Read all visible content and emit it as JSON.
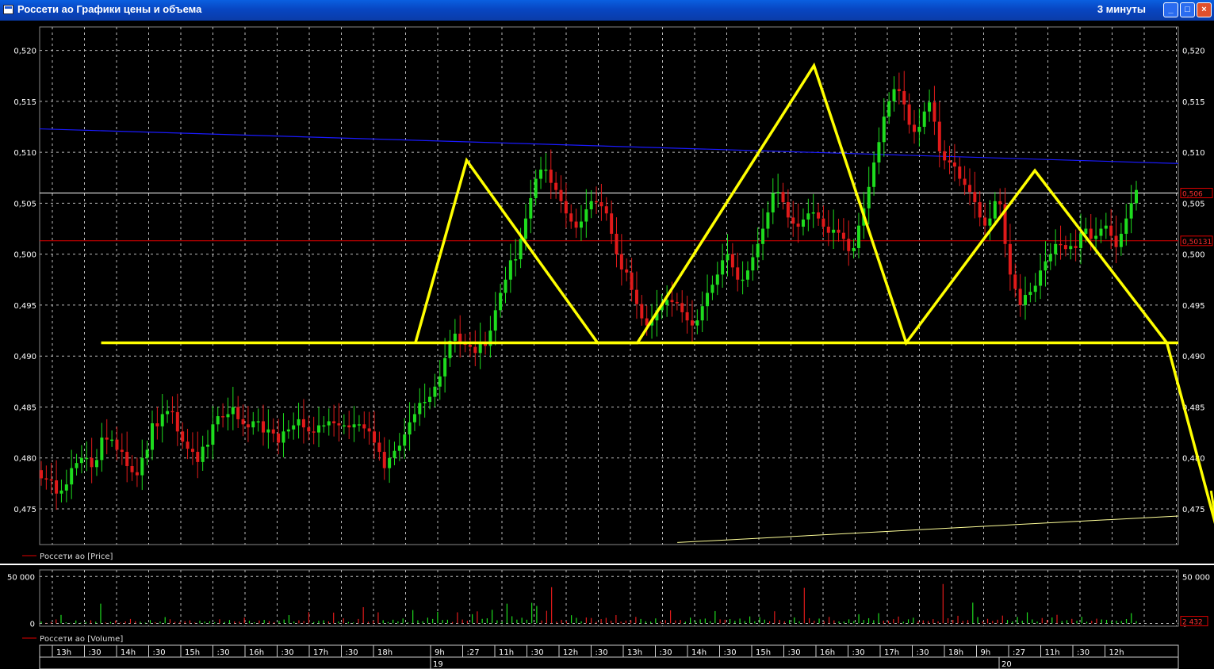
{
  "window": {
    "title": "Россети ао Графики цены и объема",
    "interval": "3 минуты",
    "minimize_glyph": "_",
    "maximize_glyph": "□",
    "close_glyph": "×"
  },
  "chart_data": {
    "type": "candlestick",
    "price_panel": {
      "legend": "Россети ао [Price]",
      "ylim": [
        0.4715,
        0.5223
      ],
      "yticks": [
        0.475,
        0.48,
        0.485,
        0.49,
        0.495,
        0.5,
        0.505,
        0.51,
        0.515,
        0.52
      ],
      "ytick_labels": [
        "0,475",
        "0,480",
        "0,485",
        "0,490",
        "0,495",
        "0,500",
        "0,505",
        "0,510",
        "0,515",
        "0,520"
      ],
      "grid": true,
      "price_markers": [
        {
          "value": 0.506,
          "label": "0,506",
          "color": "#ffffff"
        },
        {
          "value": 0.50131,
          "label": "0,50131",
          "color": "#e00000"
        }
      ],
      "moving_average": {
        "color": "#1a1aff",
        "t": [
          0,
          1
        ],
        "values": [
          0.5123,
          0.5089
        ]
      },
      "lower_line": {
        "color": "#ffff99",
        "t": [
          0.56,
          1
        ],
        "values": [
          0.4717,
          0.4743
        ]
      },
      "annotations": {
        "color": "#ffff00",
        "neckline": {
          "t": [
            0.054,
            1
          ],
          "value": 0.4913
        },
        "zigzag": {
          "t": [
            0.33,
            0.375,
            0.49,
            0.525,
            0.68,
            0.761,
            0.874,
            0.99,
            1.035
          ],
          "values": [
            0.4913,
            0.5092,
            0.4913,
            0.4913,
            0.5185,
            0.4913,
            0.5082,
            0.4913,
            0.4725
          ]
        }
      },
      "candles_close": [
        0.478,
        0.4779,
        0.4778,
        0.4765,
        0.4768,
        0.4774,
        0.479,
        0.4795,
        0.48,
        0.48,
        0.4791,
        0.4798,
        0.482,
        0.4818,
        0.4818,
        0.4808,
        0.4806,
        0.4792,
        0.4786,
        0.4783,
        0.48,
        0.4808,
        0.4834,
        0.4831,
        0.4843,
        0.4846,
        0.4845,
        0.4826,
        0.4816,
        0.4809,
        0.4806,
        0.4796,
        0.4811,
        0.4813,
        0.4833,
        0.4841,
        0.484,
        0.4843,
        0.485,
        0.4838,
        0.4833,
        0.483,
        0.4836,
        0.4836,
        0.4825,
        0.4828,
        0.4824,
        0.4815,
        0.4826,
        0.4828,
        0.4832,
        0.4838,
        0.483,
        0.4826,
        0.4825,
        0.4832,
        0.4832,
        0.4836,
        0.4834,
        0.4832,
        0.4832,
        0.483,
        0.4833,
        0.4833,
        0.4829,
        0.4826,
        0.4815,
        0.4806,
        0.479,
        0.48,
        0.4807,
        0.4812,
        0.4823,
        0.4835,
        0.4843,
        0.4854,
        0.4855,
        0.486,
        0.487,
        0.488,
        0.4898,
        0.4915,
        0.4922,
        0.4913,
        0.4911,
        0.4909,
        0.4903,
        0.4913,
        0.491,
        0.4925,
        0.4945,
        0.4962,
        0.4975,
        0.4994,
        0.4995,
        0.5015,
        0.5035,
        0.5055,
        0.5074,
        0.5083,
        0.5083,
        0.507,
        0.5063,
        0.5052,
        0.504,
        0.5032,
        0.5026,
        0.5032,
        0.5044,
        0.5052,
        0.5051,
        0.5047,
        0.504,
        0.502,
        0.5,
        0.4985,
        0.4982,
        0.4965,
        0.4951,
        0.4937,
        0.493,
        0.4935,
        0.4945,
        0.495,
        0.4955,
        0.4953,
        0.4952,
        0.4943,
        0.4935,
        0.493,
        0.4935,
        0.4949,
        0.4962,
        0.497,
        0.498,
        0.4994,
        0.5,
        0.4987,
        0.4975,
        0.4975,
        0.4984,
        0.4997,
        0.501,
        0.5025,
        0.5041,
        0.506,
        0.5061,
        0.5051,
        0.5036,
        0.503,
        0.5027,
        0.5034,
        0.504,
        0.5041,
        0.5035,
        0.5027,
        0.5021,
        0.5024,
        0.5021,
        0.5015,
        0.5003,
        0.5006,
        0.5028,
        0.5045,
        0.5066,
        0.509,
        0.511,
        0.5135,
        0.515,
        0.5162,
        0.516,
        0.5147,
        0.5127,
        0.512,
        0.5125,
        0.514,
        0.5149,
        0.513,
        0.5101,
        0.5092,
        0.509,
        0.5086,
        0.5074,
        0.5068,
        0.5061,
        0.5051,
        0.5036,
        0.5028,
        0.5035,
        0.5052,
        0.5049,
        0.501,
        0.498,
        0.4966,
        0.495,
        0.496,
        0.4963,
        0.4969,
        0.4984,
        0.4993,
        0.5,
        0.501,
        0.5009,
        0.5005,
        0.5008,
        0.5006,
        0.502,
        0.5025,
        0.5015,
        0.5018,
        0.5025,
        0.5028,
        0.5018,
        0.5007,
        0.502,
        0.5035,
        0.505,
        0.5063
      ]
    },
    "volume_panel": {
      "legend": "Россети ао [Volume]",
      "ylim": [
        -3000,
        57000
      ],
      "yticks": [
        0,
        50000
      ],
      "ytick_labels": [
        "0",
        "50 000"
      ],
      "last_value": 2432,
      "last_label": "2 432",
      "values": [
        2000,
        600,
        1400,
        4200,
        9000,
        1100,
        500,
        3100,
        700,
        1600,
        3300,
        1800,
        21000,
        1000,
        1500,
        2900,
        800,
        2100,
        4700,
        2300,
        1700,
        800,
        3500,
        1200,
        1800,
        6700,
        4400,
        1700,
        1500,
        2300,
        3200,
        900,
        2800,
        1900,
        2200,
        1100,
        4400,
        1500,
        3600,
        2100,
        1800,
        6100,
        2800,
        1200,
        3100,
        3700,
        2400,
        1300,
        2600,
        4100,
        8800,
        1900,
        3300,
        2500,
        12000,
        1400,
        2800,
        3300,
        2100,
        11500,
        1900,
        5400,
        1500,
        900,
        4700,
        17300,
        1800,
        2900,
        11800,
        3400,
        1500,
        3900,
        2100,
        5200,
        1100,
        14200,
        3300,
        2300,
        6100,
        4700,
        12300,
        3700,
        3900,
        1500,
        11800,
        4100,
        2800,
        9800,
        12800,
        4800,
        5400,
        14500,
        3300,
        1800,
        21000,
        7600,
        4000,
        6000,
        3900,
        21900,
        18600,
        3200,
        13400,
        38600,
        1800,
        3800,
        2100,
        8700,
        5900,
        2200,
        6300,
        5700,
        1700,
        4600,
        5900,
        2900,
        8800,
        1800,
        3000,
        3400,
        6900,
        4700,
        2200,
        1800,
        5300,
        1800,
        3500,
        13900,
        3200,
        3700,
        1800,
        6100,
        2500,
        4300,
        5100,
        2300,
        13100,
        4300,
        3900,
        4600,
        2700,
        5100,
        2500,
        7400,
        2200,
        6600,
        4000,
        2300,
        12900,
        3800,
        2200,
        3600,
        6300,
        2200,
        37900,
        5500,
        2800,
        5100,
        2300,
        6900,
        3200,
        2100,
        1900,
        4300,
        2500,
        9800,
        3600,
        5500,
        3400,
        10900,
        2800,
        2700,
        4500,
        7300,
        1700,
        4300,
        6100,
        2300,
        3200,
        2500,
        4500,
        2200,
        42000,
        5500,
        3700,
        8100,
        2600,
        3500,
        22100,
        6800,
        2000,
        4800,
        2600,
        3900,
        8300,
        3700,
        2100,
        6900,
        2900,
        11800,
        4200,
        1900,
        5700,
        3700,
        6300,
        9100,
        2500,
        3400,
        4800,
        2900,
        7100,
        1700,
        2700,
        5000,
        4200,
        3800,
        2400,
        2900,
        2600,
        4600,
        10900,
        2432
      ]
    },
    "time_axis": {
      "labels": [
        "13h",
        ":30",
        "14h",
        ":30",
        "15h",
        ":30",
        "16h",
        ":30",
        "17h",
        ":30",
        "18h",
        "9h",
        ":27",
        "11h",
        ":30",
        "12h",
        ":30",
        "13h",
        ":30",
        "14h",
        ":30",
        "15h",
        ":30",
        "16h",
        ":30",
        "17h",
        ":30",
        "18h",
        "9h",
        ":27",
        "11h",
        ":30",
        "12h"
      ],
      "dates": [
        "19",
        "20"
      ]
    }
  }
}
